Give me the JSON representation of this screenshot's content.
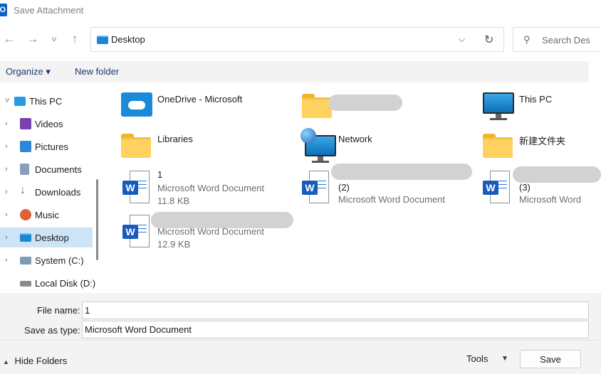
{
  "window": {
    "title": "Save Attachment",
    "app_icon_letter": "O"
  },
  "toolbar": {
    "back_glyph": "←",
    "forward_glyph": "→",
    "recent_glyph": "˅",
    "up_glyph": "↑",
    "address": "Desktop",
    "address_chevron": "⌵",
    "refresh_glyph": "↻",
    "search_placeholder": "Search Des",
    "search_glyph": "⚲"
  },
  "commands": {
    "organize": "Organize ▾",
    "new_folder": "New folder"
  },
  "sidebar": {
    "items": [
      {
        "label": "This PC",
        "chev": "˅",
        "icon": "pc-icon",
        "color": "#2a9be0"
      },
      {
        "label": "Videos",
        "chev": "›",
        "icon": "videos-icon",
        "color": "#7a3fb0"
      },
      {
        "label": "Pictures",
        "chev": "›",
        "icon": "pictures-icon",
        "color": "#2b88d8"
      },
      {
        "label": "Documents",
        "chev": "›",
        "icon": "documents-icon",
        "color": "#8aa0b8"
      },
      {
        "label": "Downloads",
        "chev": "›",
        "icon": "downloads-icon",
        "color": "#1e9e5a"
      },
      {
        "label": "Music",
        "chev": "›",
        "icon": "music-icon",
        "color": "#e0603a"
      },
      {
        "label": "Desktop",
        "chev": "›",
        "icon": "desktop-icon",
        "color": "#1a86d6"
      },
      {
        "label": "System (C:)",
        "chev": "›",
        "icon": "drive-c-icon",
        "color": "#7f9ab3"
      },
      {
        "label": "Local Disk (D:)",
        "chev": "",
        "icon": "drive-d-icon",
        "color": "#8a8a8a"
      }
    ]
  },
  "content": {
    "onedrive": {
      "name": "OneDrive - Microsoft"
    },
    "folder_redacted": {
      "name": ""
    },
    "thispc": {
      "name": "This PC"
    },
    "libraries": {
      "name": "Libraries"
    },
    "network": {
      "name": "Network"
    },
    "new_folder": {
      "name": "新建文件夹"
    },
    "doc1": {
      "name": "1",
      "type": "Microsoft Word Document",
      "size": "11.8 KB"
    },
    "doc2": {
      "name": "(2)",
      "type": "Microsoft Word Document"
    },
    "doc3": {
      "name": "(3)",
      "type": "Microsoft Word"
    },
    "doc4": {
      "type": "Microsoft Word Document",
      "size": "12.9 KB"
    },
    "word_badge": "W"
  },
  "form": {
    "file_name_label": "File name:",
    "file_name_value": "1",
    "save_as_label": "Save as type:",
    "save_as_value": "Microsoft Word Document"
  },
  "footer": {
    "hide_folders": "Hide Folders",
    "hide_caret": "▲",
    "tools": "Tools",
    "tools_caret": "▼",
    "save": "Save"
  }
}
